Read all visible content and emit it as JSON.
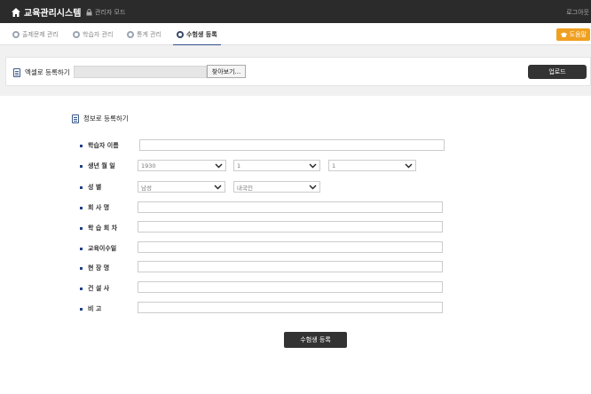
{
  "header": {
    "brand": "교육관리시스템",
    "admin_mode": "관리자 모드",
    "logout": "로그아웃"
  },
  "tabs": [
    {
      "label": "출제문제 관리",
      "active": false
    },
    {
      "label": "학습자 관리",
      "active": false
    },
    {
      "label": "통계 관리",
      "active": false
    },
    {
      "label": "수험생 등록",
      "active": true
    }
  ],
  "manual_label": "도움말",
  "excel": {
    "title": "엑셀로 등록하기",
    "file_value": "",
    "browse_label": "찾아보기...",
    "upload_label": "업로드"
  },
  "form": {
    "title": "정보로 등록하기",
    "fields": {
      "name": {
        "label": "학습자 이름",
        "value": ""
      },
      "birth": {
        "label": "생년 월 일",
        "year": "1930",
        "month": "1",
        "day": "1"
      },
      "gender": {
        "label": "성 별",
        "gender": "남성",
        "nationality": "내국인"
      },
      "company": {
        "label": "회 사 명",
        "value": ""
      },
      "session": {
        "label": "학 습 회 차",
        "value": ""
      },
      "completion": {
        "label": "교육이수일",
        "value": ""
      },
      "site": {
        "label": "현 장 명",
        "value": ""
      },
      "contractor": {
        "label": "건 설 사",
        "value": ""
      },
      "note": {
        "label": "비 고",
        "value": ""
      }
    },
    "submit_label": "수험생 등록"
  },
  "colors": {
    "topbar": "#2b2b2b",
    "accent": "#2f4f8f",
    "manual": "#f0a020",
    "button_dark": "#333333"
  }
}
